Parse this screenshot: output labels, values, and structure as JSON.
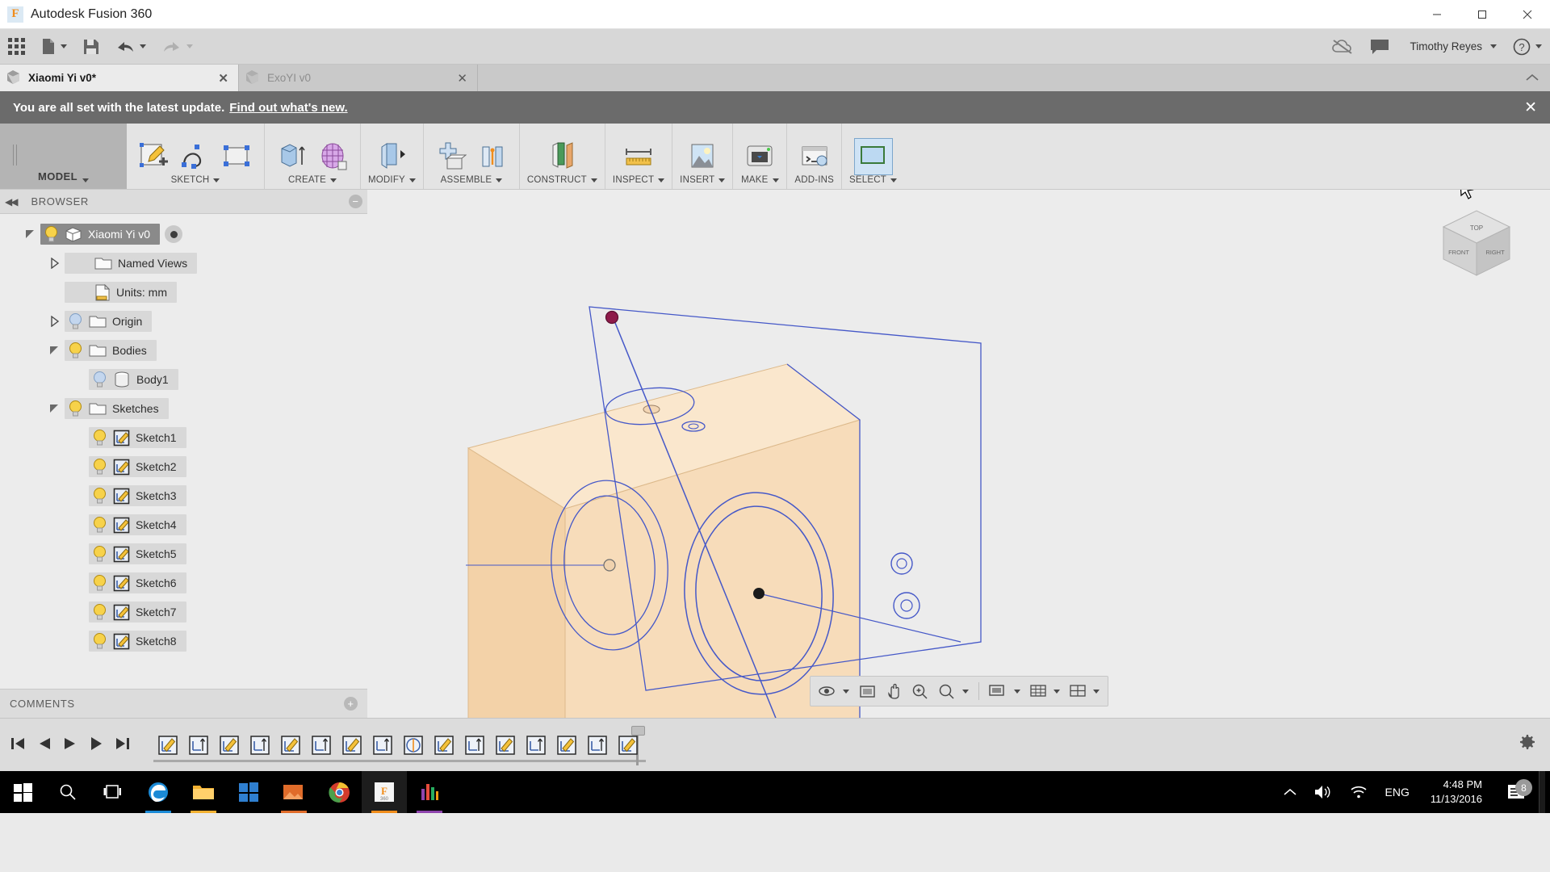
{
  "window": {
    "app_title": "Autodesk Fusion 360",
    "logo_letter": "F",
    "minimize": "—",
    "maximize": "❐",
    "close": "✕"
  },
  "quick_access": {
    "items": [
      {
        "name": "app-grid-icon",
        "label": ""
      },
      {
        "name": "new-file-icon",
        "label": "",
        "has_caret": true
      },
      {
        "name": "save-icon",
        "label": ""
      },
      {
        "name": "undo-icon",
        "label": "",
        "has_caret": true
      },
      {
        "name": "redo-icon",
        "label": "",
        "has_caret": true
      }
    ],
    "user_name": "Timothy Reyes",
    "help_label": "?",
    "offline_icon": "cloud-offline-icon",
    "comment_icon": "speech-bubble-icon"
  },
  "tabs": [
    {
      "label": "Xiaomi Yi v0*",
      "active": true,
      "close": "✕"
    },
    {
      "label": "ExoYI v0",
      "active": false,
      "close": "✕"
    }
  ],
  "notification": {
    "message": "You are all set with the latest update.",
    "link": "Find out what's new.",
    "close": "✕"
  },
  "ribbon": {
    "workspace_label": "MODEL",
    "groups": [
      {
        "label": "SKETCH",
        "caret": true,
        "commands": [
          "create-sketch-icon",
          "sketch-spline-icon",
          "sketch-rectangle-icon"
        ]
      },
      {
        "label": "CREATE",
        "caret": true,
        "commands": [
          "extrude-icon",
          "sculpt-form-icon"
        ]
      },
      {
        "label": "MODIFY",
        "caret": true,
        "commands": [
          "press-pull-icon"
        ]
      },
      {
        "label": "ASSEMBLE",
        "caret": true,
        "commands": [
          "new-component-icon",
          "joint-icon"
        ]
      },
      {
        "label": "CONSTRUCT",
        "caret": true,
        "commands": [
          "offset-plane-icon"
        ]
      },
      {
        "label": "INSPECT",
        "caret": true,
        "commands": [
          "measure-icon"
        ]
      },
      {
        "label": "INSERT",
        "caret": true,
        "commands": [
          "insert-image-icon"
        ]
      },
      {
        "label": "MAKE",
        "caret": true,
        "commands": [
          "3d-print-icon"
        ]
      },
      {
        "label": "ADD-INS",
        "caret": false,
        "commands": [
          "scripts-addins-icon"
        ]
      },
      {
        "label": "SELECT",
        "caret": true,
        "commands": [
          "select-window-icon"
        ]
      }
    ]
  },
  "browser": {
    "title": "BROWSER",
    "collapse_icon": "double-left-arrow-icon",
    "minus_icon": "−",
    "tree": [
      {
        "label": "Xiaomi Yi v0",
        "indent": 0,
        "expander": "expanded",
        "bulb": "on",
        "icon": "component-icon",
        "selected": true,
        "has_radio": true
      },
      {
        "label": "Named Views",
        "indent": 1,
        "expander": "collapsed",
        "bulb": "none",
        "icon": "folder-icon",
        "selected": false
      },
      {
        "label": "Units: mm",
        "indent": 1,
        "expander": "none",
        "bulb": "none",
        "icon": "units-icon",
        "selected": false
      },
      {
        "label": "Origin",
        "indent": 1,
        "expander": "collapsed",
        "bulb": "off",
        "icon": "folder-icon",
        "selected": false
      },
      {
        "label": "Bodies",
        "indent": 1,
        "expander": "expanded",
        "bulb": "on",
        "icon": "folder-icon",
        "selected": false
      },
      {
        "label": "Body1",
        "indent": 2,
        "expander": "none",
        "bulb": "off",
        "icon": "body-icon",
        "selected": false
      },
      {
        "label": "Sketches",
        "indent": 1,
        "expander": "expanded",
        "bulb": "on",
        "icon": "folder-icon",
        "selected": false
      },
      {
        "label": "Sketch1",
        "indent": 2,
        "expander": "none",
        "bulb": "on",
        "icon": "sketch-icon",
        "selected": false
      },
      {
        "label": "Sketch2",
        "indent": 2,
        "expander": "none",
        "bulb": "on",
        "icon": "sketch-icon",
        "selected": false
      },
      {
        "label": "Sketch3",
        "indent": 2,
        "expander": "none",
        "bulb": "on",
        "icon": "sketch-icon",
        "selected": false
      },
      {
        "label": "Sketch4",
        "indent": 2,
        "expander": "none",
        "bulb": "on",
        "icon": "sketch-icon",
        "selected": false
      },
      {
        "label": "Sketch5",
        "indent": 2,
        "expander": "none",
        "bulb": "on",
        "icon": "sketch-icon",
        "selected": false
      },
      {
        "label": "Sketch6",
        "indent": 2,
        "expander": "none",
        "bulb": "on",
        "icon": "sketch-icon",
        "selected": false
      },
      {
        "label": "Sketch7",
        "indent": 2,
        "expander": "none",
        "bulb": "on",
        "icon": "sketch-icon",
        "selected": false
      },
      {
        "label": "Sketch8",
        "indent": 2,
        "expander": "none",
        "bulb": "on",
        "icon": "sketch-icon",
        "selected": false
      }
    ],
    "comments_label": "COMMENTS",
    "comments_plus": "+"
  },
  "navcube": {
    "top_label": "TOP",
    "front_label": "FRONT",
    "right_label": "RIGHT"
  },
  "view_toolbar": {
    "items": [
      {
        "name": "orbit-icon",
        "caret": true
      },
      {
        "name": "look-at-icon",
        "caret": false
      },
      {
        "name": "pan-icon",
        "caret": false
      },
      {
        "name": "zoom-icon",
        "caret": false
      },
      {
        "name": "fit-icon",
        "caret": true
      },
      {
        "name": "display-settings-icon",
        "caret": true
      },
      {
        "name": "grid-snaps-icon",
        "caret": true
      },
      {
        "name": "viewports-icon",
        "caret": true
      }
    ]
  },
  "timeline": {
    "playback": [
      "skip-start-icon",
      "step-back-icon",
      "step-forward-icon",
      "play-icon",
      "skip-end-icon"
    ],
    "features": [
      "sketch-feature-icon",
      "extrude-feature-icon",
      "sketch-feature-icon",
      "extrude-feature-icon",
      "sketch-feature-icon",
      "extrude-feature-icon",
      "sketch-feature-icon",
      "extrude-feature-icon",
      "revolve-feature-icon",
      "sketch-feature-icon",
      "extrude-feature-icon",
      "sketch-feature-icon",
      "extrude-feature-icon",
      "sketch-feature-icon",
      "extrude-feature-icon",
      "sketch-feature-icon"
    ],
    "settings_icon": "gear-icon"
  },
  "taskbar": {
    "start_icon": "windows-start-icon",
    "items": [
      {
        "name": "search-icon",
        "accent": ""
      },
      {
        "name": "task-view-icon",
        "accent": ""
      },
      {
        "name": "edge-icon",
        "accent": "#1b8ad6"
      },
      {
        "name": "file-explorer-icon",
        "accent": "#f2b131"
      },
      {
        "name": "store-icon",
        "accent": "#2f7fd0"
      },
      {
        "name": "photos-icon",
        "accent": "#e06c2a"
      },
      {
        "name": "chrome-icon",
        "accent": "#d33b2c"
      },
      {
        "name": "fusion360-icon",
        "accent": "#f08d1c",
        "active": true
      },
      {
        "name": "audio-app-icon",
        "accent": "#8e44ad"
      }
    ],
    "tray": {
      "chevron": "∧",
      "volume_icon": "speaker-icon",
      "network_icon": "wifi-icon",
      "language": "ENG",
      "time": "4:48 PM",
      "date": "11/13/2016",
      "notification_count": "8"
    }
  },
  "colors": {
    "model_fill": "#f6d9b4",
    "model_fill_light": "#fae5c8",
    "sketch_line": "#4558c8",
    "accent_orange": "#f08d1c",
    "notif_bg": "#6b6b6b"
  }
}
